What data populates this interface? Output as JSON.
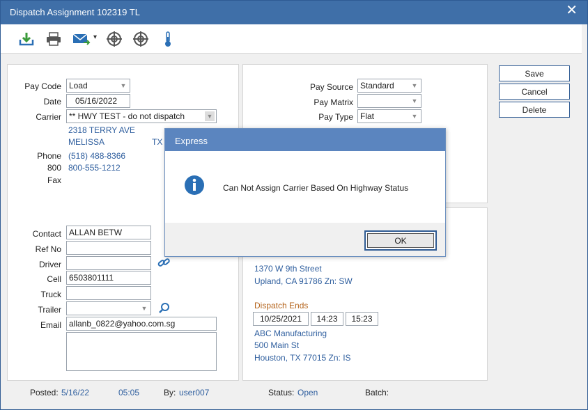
{
  "window": {
    "title": "Dispatch Assignment 102319 TL",
    "close_glyph": "✕"
  },
  "toolbar": {
    "icons": [
      "download-icon",
      "print-icon",
      "email-icon",
      "crosshair-icon",
      "crosshair-icon",
      "thermometer-icon"
    ],
    "dropdown_glyph": "▾"
  },
  "left": {
    "pay_code_label": "Pay Code",
    "pay_code_value": "Load",
    "date_label": "Date",
    "date_value": "05/16/2022",
    "carrier_label": "Carrier",
    "carrier_value": "** HWY TEST - do not dispatch",
    "address1": "2318 TERRY AVE",
    "city": "MELISSA",
    "state": "TX",
    "phone_label": "Phone",
    "phone_value": "(518) 488-8366",
    "tollfree_label": "800",
    "tollfree_value": "800-555-1212",
    "fax_label": "Fax",
    "contact_label": "Contact",
    "contact_value": "ALLAN BETW",
    "refno_label": "Ref No",
    "refno_value": "",
    "driver_label": "Driver",
    "driver_value": "",
    "cell_label": "Cell",
    "cell_value": "6503801111",
    "truck_label": "Truck",
    "truck_value": "",
    "trailer_label": "Trailer",
    "trailer_value": "",
    "email_label": "Email",
    "email_value": "allanb_0822@yahoo.com.sg"
  },
  "right": {
    "pay_source_label": "Pay Source",
    "pay_source_value": "Standard",
    "pay_matrix_label": "Pay Matrix",
    "pay_matrix_value": "",
    "pay_type_label": "Pay Type",
    "pay_type_value": "Flat",
    "start_address1": "1370 W 9th Street",
    "start_address2": "Upland, CA 91786 Zn: SW",
    "dispatch_ends_label": "Dispatch Ends",
    "end_date": "10/25/2021",
    "end_time1": "14:23",
    "end_time2": "15:23",
    "end_company": "ABC Manufacturing",
    "end_address1": "500 Main St",
    "end_address2": "Houston, TX 77015 Zn: IS"
  },
  "buttons": {
    "save": "Save",
    "cancel": "Cancel",
    "delete": "Delete"
  },
  "footer": {
    "posted_label": "Posted:",
    "posted_date": "5/16/22",
    "posted_time": "05:05",
    "by_label": "By:",
    "by_value": "user007",
    "status_label": "Status:",
    "status_value": "Open",
    "batch_label": "Batch:"
  },
  "dialog": {
    "title": "Express",
    "icon": "info-icon",
    "message": "Can Not Assign Carrier Based On Highway Status",
    "ok": "OK"
  },
  "colors": {
    "titlebar": "#3f6fa8",
    "dialog_titlebar": "#5b85bf",
    "link_text": "#2e5e9e",
    "dispatch_ends": "#b5651d"
  }
}
